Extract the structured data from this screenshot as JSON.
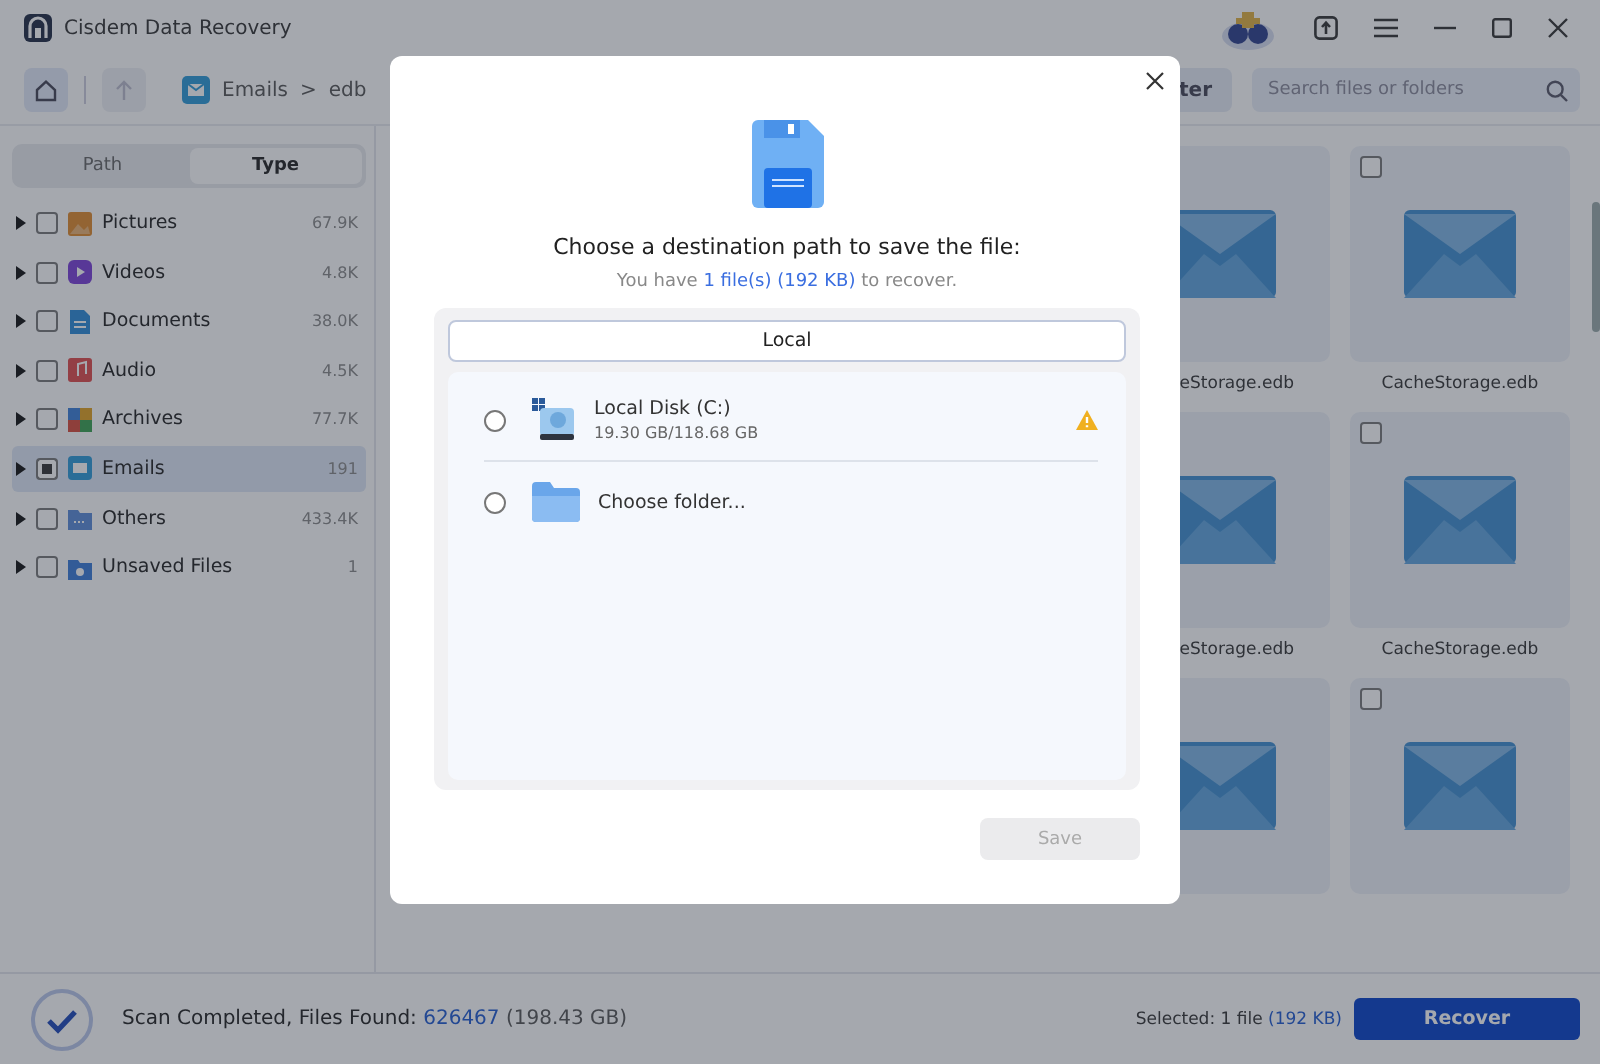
{
  "window": {
    "title": "Cisdem Data Recovery"
  },
  "toolbar": {
    "breadcrumb": [
      {
        "label": "Emails",
        "kind": "email"
      },
      {
        "label": "edb",
        "kind": "plain"
      }
    ],
    "separator": ">",
    "filter_button": "ter",
    "search": {
      "placeholder": "Search files or folders"
    }
  },
  "sidebar": {
    "tabs": [
      {
        "label": "Path",
        "selected": false
      },
      {
        "label": "Type",
        "selected": true
      }
    ],
    "items": [
      {
        "name": "Pictures",
        "count": "67.9K",
        "kind": "pictures",
        "checked": false,
        "selected": false
      },
      {
        "name": "Videos",
        "count": "4.8K",
        "kind": "videos",
        "checked": false,
        "selected": false
      },
      {
        "name": "Documents",
        "count": "38.0K",
        "kind": "documents",
        "checked": false,
        "selected": false
      },
      {
        "name": "Audio",
        "count": "4.5K",
        "kind": "audio",
        "checked": false,
        "selected": false
      },
      {
        "name": "Archives",
        "count": "77.7K",
        "kind": "archives",
        "checked": false,
        "selected": false
      },
      {
        "name": "Emails",
        "count": "191",
        "kind": "emails",
        "checked": true,
        "selected": true
      },
      {
        "name": "Others",
        "count": "433.4K",
        "kind": "others",
        "checked": false,
        "selected": false
      },
      {
        "name": "Unsaved Files",
        "count": "1",
        "kind": "unsaved",
        "checked": false,
        "selected": false
      }
    ]
  },
  "file_grid": {
    "rows": [
      {
        "cards": [
          {
            "label": "eStorage.edb"
          },
          {
            "label": "CacheStorage.edb",
            "checked": false
          }
        ]
      },
      {
        "cards": [
          {
            "label": "eStorage.edb"
          },
          {
            "label": "CacheStorage.edb",
            "checked": false
          }
        ]
      },
      {
        "cards": [
          {
            "checked": false
          }
        ]
      }
    ]
  },
  "status_bar": {
    "text": "Scan Completed, Files Found:",
    "count": "626467",
    "size": "(198.43 GB)",
    "selected_text": "Selected: 1 file",
    "selected_size": "(192 KB)",
    "recover_button": "Recover"
  },
  "dialog": {
    "title": "Choose a destination path to save the file:",
    "subtitle_before": "You have",
    "subtitle_highlight": "1 file(s) (192 KB)",
    "subtitle_after": "to recover.",
    "tabs": [
      {
        "label": "Local",
        "selected": true
      }
    ],
    "destinations": [
      {
        "kind": "disk",
        "name": "Local Disk (C:)",
        "detail": "19.30 GB/118.68 GB",
        "warning": true,
        "selected": false
      },
      {
        "kind": "folder",
        "name": "Choose folder...",
        "warning": false,
        "selected": false
      }
    ],
    "save_button": {
      "label": "Save",
      "disabled": true
    }
  }
}
